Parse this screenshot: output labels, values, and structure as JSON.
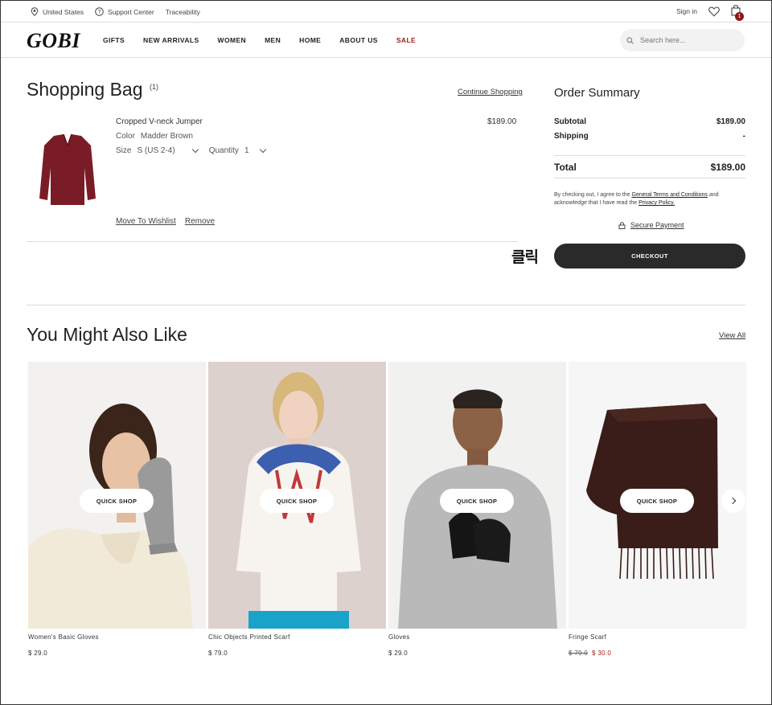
{
  "topbar": {
    "region": "United States",
    "support": "Support Center",
    "traceability": "Traceability",
    "signin": "Sign in",
    "cart_count": "1"
  },
  "nav": {
    "logo": "GOBI",
    "links": [
      "GIFTS",
      "NEW ARRIVALS",
      "WOMEN",
      "MEN",
      "HOME",
      "ABOUT US",
      "SALE"
    ],
    "search_placeholder": "Search here..."
  },
  "bag": {
    "title": "Shopping Bag",
    "count": "(1)",
    "continue": "Continue Shopping",
    "item": {
      "name": "Cropped V-neck Jumper",
      "price": "$189.00",
      "color_label": "Color",
      "color_value": "Madder Brown",
      "size_label": "Size",
      "size_value": "S (US 2-4)",
      "qty_label": "Quantity",
      "qty_value": "1",
      "wishlist": "Move To Wishlist",
      "remove": "Remove"
    }
  },
  "summary": {
    "title": "Order Summary",
    "subtotal_label": "Subtotal",
    "subtotal_value": "$189.00",
    "shipping_label": "Shipping",
    "shipping_value": "-",
    "total_label": "Total",
    "total_value": "$189.00",
    "terms_pre": "By checking out, I agree to the ",
    "terms_link": "General Terms and Conditions",
    "terms_mid": " and acknowledge that I have read the ",
    "privacy_link": "Privacy Policy.",
    "secure": "Secure Payment",
    "checkout": "CHECKOUT",
    "annotation": "클릭"
  },
  "recommend": {
    "title": "You Might Also Like",
    "view_all": "View All",
    "quick_shop": "QUICK SHOP",
    "products": [
      {
        "name": "Women's Basic Gloves",
        "price": "$ 29.0"
      },
      {
        "name": "Chic Objects Printed Scarf",
        "price": "$ 79.0"
      },
      {
        "name": "Gloves",
        "price": "$ 29.0"
      },
      {
        "name": "Fringe Scarf",
        "old_price": "$ 79.0",
        "price": "$ 30.0"
      }
    ]
  },
  "colors": {
    "accent": "#9b1b1b",
    "button": "#2a2a2a",
    "jumper": "#7a1c26"
  }
}
